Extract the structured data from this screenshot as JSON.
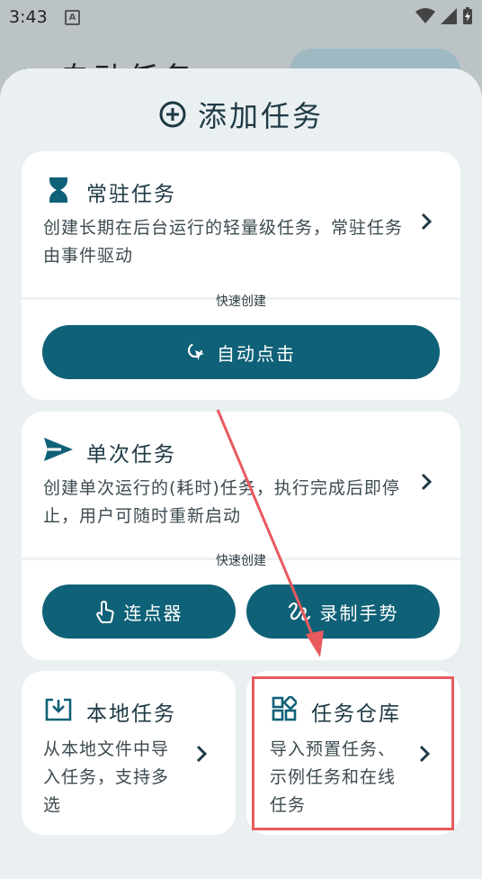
{
  "statusbar": {
    "time": "3:43",
    "notif_glyph": "A"
  },
  "background": {
    "title": "自动任务"
  },
  "sheet": {
    "title": "添加任务",
    "resident": {
      "title": "常驻任务",
      "desc": "创建长期在后台运行的轻量级任务，常驻任务由事件驱动",
      "quick_label": "快速创建",
      "button": "自动点击"
    },
    "single": {
      "title": "单次任务",
      "desc": "创建单次运行的(耗时)任务，执行完成后即停止，用户可随时重新启动",
      "quick_label": "快速创建",
      "button_left": "连点器",
      "button_right": "录制手势"
    },
    "local": {
      "title": "本地任务",
      "desc": "从本地文件中导入任务，支持多选"
    },
    "repo": {
      "title": "任务仓库",
      "desc": "导入预置任务、示例任务和在线任务"
    }
  },
  "colors": {
    "accent": "#0f6177",
    "annotation": "#e85a5e"
  }
}
